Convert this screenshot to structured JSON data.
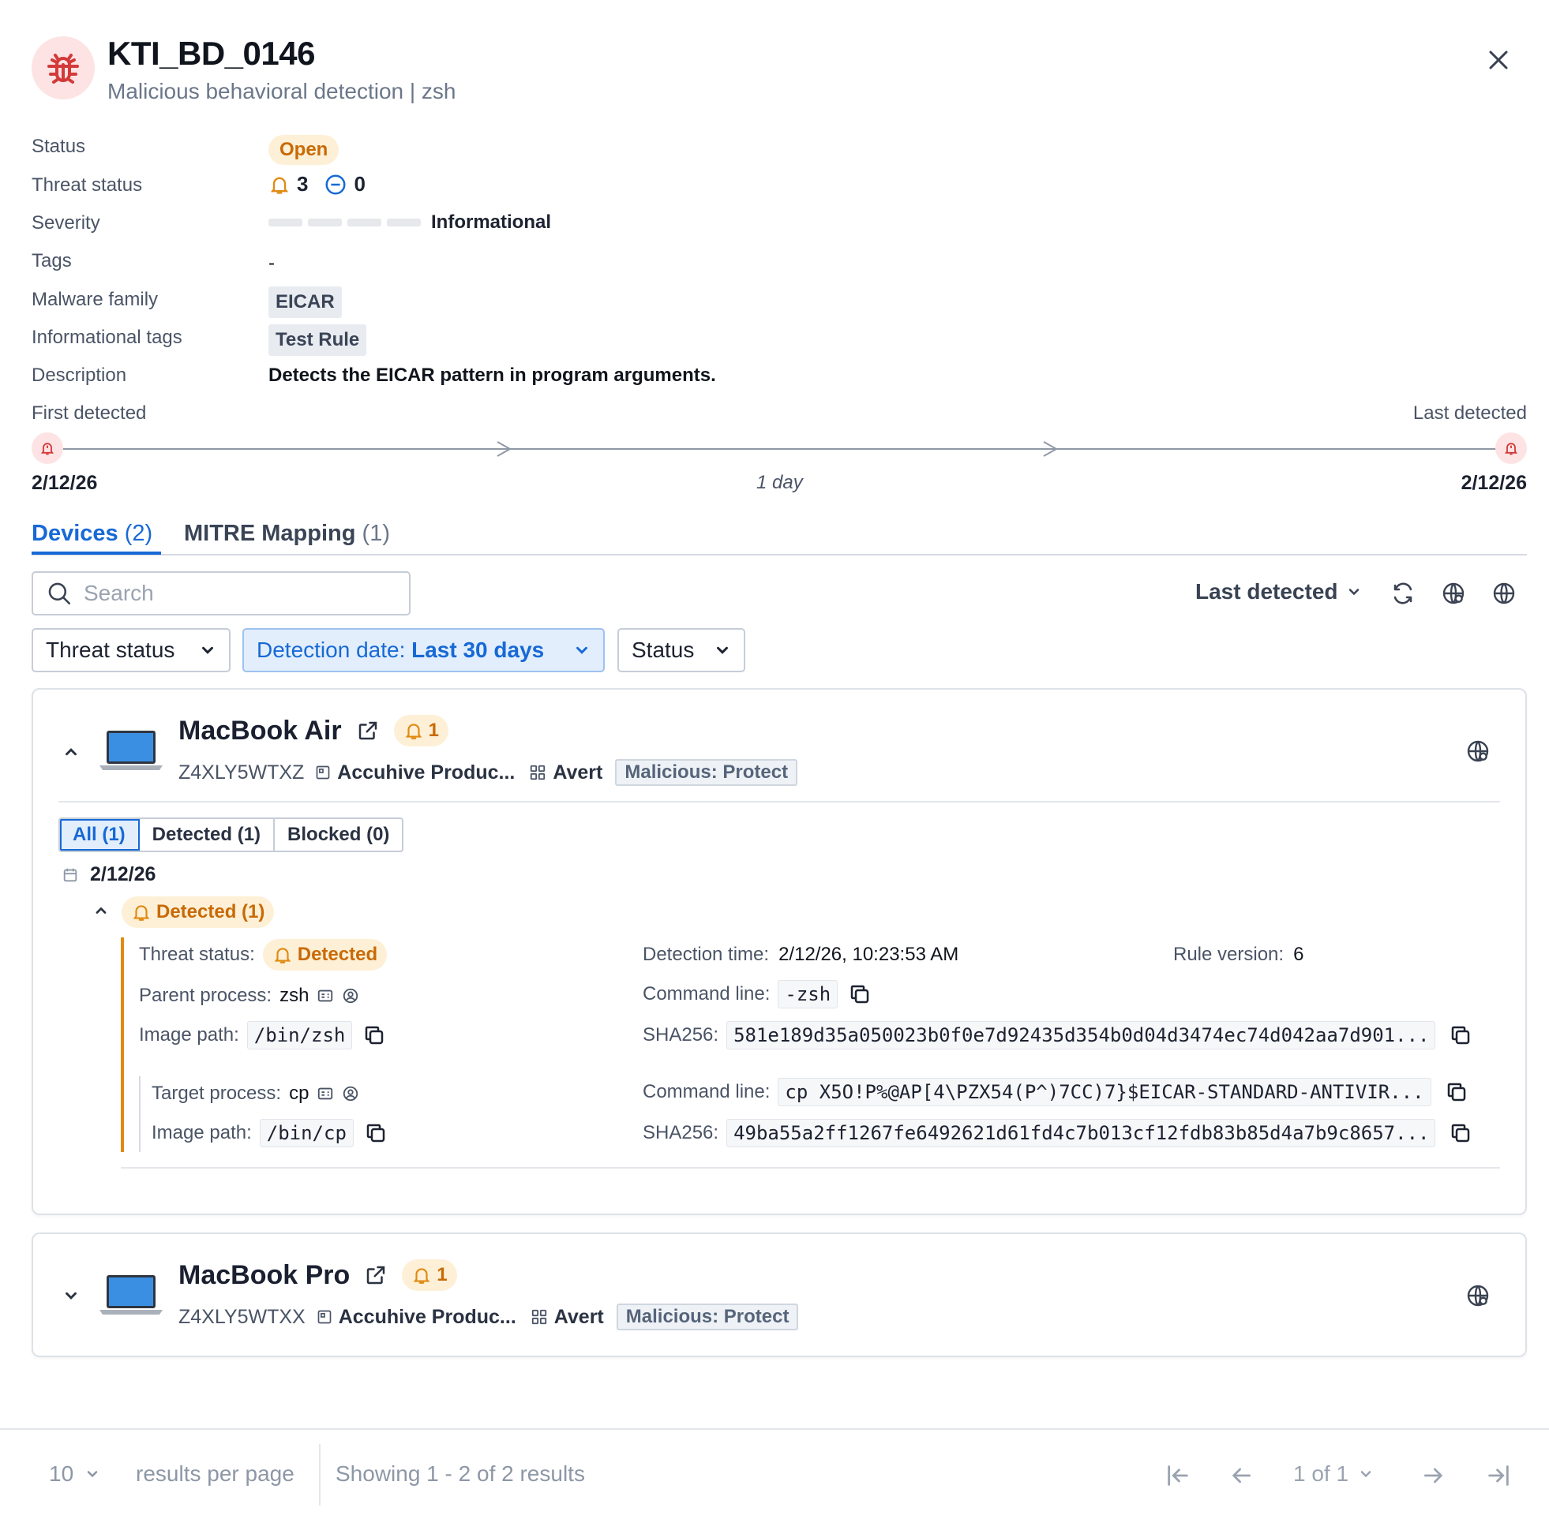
{
  "header": {
    "title": "KTI_BD_0146",
    "subtitle": "Malicious behavioral detection | zsh"
  },
  "properties": {
    "status_label": "Status",
    "status_value": "Open",
    "threat_status_label": "Threat status",
    "threat_detected_count": "3",
    "threat_blocked_count": "0",
    "severity_label": "Severity",
    "severity_value": "Informational",
    "tags_label": "Tags",
    "tags_value": "-",
    "malware_family_label": "Malware family",
    "malware_family_value": "EICAR",
    "informational_tags_label": "Informational tags",
    "informational_tags_value": "Test Rule",
    "description_label": "Description",
    "description_value": "Detects the EICAR pattern in program arguments."
  },
  "timeline": {
    "first_label": "First detected",
    "last_label": "Last detected",
    "first_date": "2/12/26",
    "last_date": "2/12/26",
    "duration": "1 day"
  },
  "tabs": {
    "devices_label": "Devices",
    "devices_count": "(2)",
    "mitre_label": "MITRE Mapping",
    "mitre_count": "(1)"
  },
  "toolbar": {
    "search_placeholder": "Search",
    "sort_label": "Last detected",
    "filter_threat": "Threat status",
    "filter_date_prefix": "Detection date: ",
    "filter_date_value": "Last 30 days",
    "filter_status": "Status"
  },
  "devices": [
    {
      "name": "MacBook Air",
      "alert_count": "1",
      "serial": "Z4XLY5WTXZ",
      "product": "Accuhive Produc...",
      "group": "Avert",
      "policy": "Malicious: Protect",
      "segments": [
        "All (1)",
        "Detected (1)",
        "Blocked (0)"
      ],
      "date": "2/12/26",
      "detected_group": "Detected (1)",
      "detail": {
        "threat_status_label": "Threat status:",
        "threat_status_value": "Detected",
        "detection_time_label": "Detection time:",
        "detection_time_value": "2/12/26, 10:23:53 AM",
        "rule_version_label": "Rule version:",
        "rule_version_value": "6",
        "parent_process_label": "Parent process:",
        "parent_process_value": "zsh",
        "parent_cmd_label": "Command line:",
        "parent_cmd_value": "-zsh",
        "parent_image_label": "Image path:",
        "parent_image_value": "/bin/zsh",
        "parent_sha_label": "SHA256:",
        "parent_sha_value": "581e189d35a050023b0f0e7d92435d354b0d04d3474ec74d042aa7d901...",
        "target_process_label": "Target process:",
        "target_process_value": "cp",
        "target_cmd_label": "Command line:",
        "target_cmd_value": "cp X5O!P%@AP[4\\PZX54(P^)7CC)7}$EICAR-STANDARD-ANTIVIR...",
        "target_image_label": "Image path:",
        "target_image_value": "/bin/cp",
        "target_sha_label": "SHA256:",
        "target_sha_value": "49ba55a2ff1267fe6492621d61fd4c7b013cf12fdb83b85d4a7b9c8657..."
      }
    },
    {
      "name": "MacBook Pro",
      "alert_count": "1",
      "serial": "Z4XLY5WTXX",
      "product": "Accuhive Produc...",
      "group": "Avert",
      "policy": "Malicious: Protect"
    }
  ],
  "footer": {
    "page_size": "10",
    "per_page_label": "results per page",
    "showing": "Showing 1 - 2 of 2 results",
    "page_indicator": "1 of 1"
  },
  "colors": {
    "accent": "#1769d6",
    "warning": "#c96a06",
    "danger": "#d93b3b"
  }
}
